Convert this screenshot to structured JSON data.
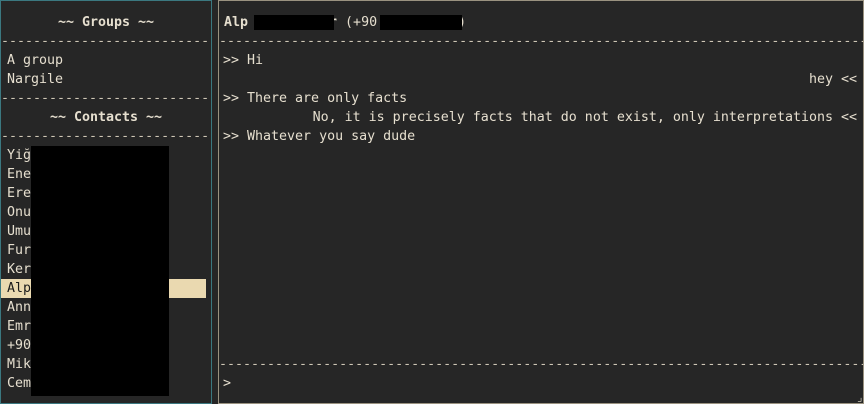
{
  "groups": {
    "heading": "~~ Groups ~~",
    "items": [
      "A group",
      "Nargile"
    ]
  },
  "contacts": {
    "heading": "~~ Contacts ~~",
    "items": [
      "Yiğ",
      "Ene",
      "Ere",
      "Onu",
      "Umu",
      "Fur",
      "Ker",
      "Alp",
      "Ann",
      "Emr",
      "+90",
      "Mik",
      "Cem"
    ],
    "selected_index": 7
  },
  "rule": "-------------------------------------------------------------------------------------",
  "chat": {
    "title_name": "Alp",
    "title_suffix": "r",
    "title_phone": " (+90",
    "title_close": ")",
    "messages": [
      {
        "direction": "in",
        "text": ">> Hi"
      },
      {
        "direction": "out",
        "text": "hey <<"
      },
      {
        "direction": "in",
        "text": ">> There are only facts"
      },
      {
        "direction": "out",
        "text": "No, it is precisely facts that do not exist, only interpretations <<"
      },
      {
        "direction": "in",
        "text": ">> Whatever you say dude"
      }
    ],
    "input_prompt": ">",
    "input_value": ""
  },
  "colors": {
    "background": "#262626",
    "text": "#e6dfcf",
    "selection": "#ead9b0",
    "left_border": "#3b7880",
    "right_border": "#9a9280"
  }
}
